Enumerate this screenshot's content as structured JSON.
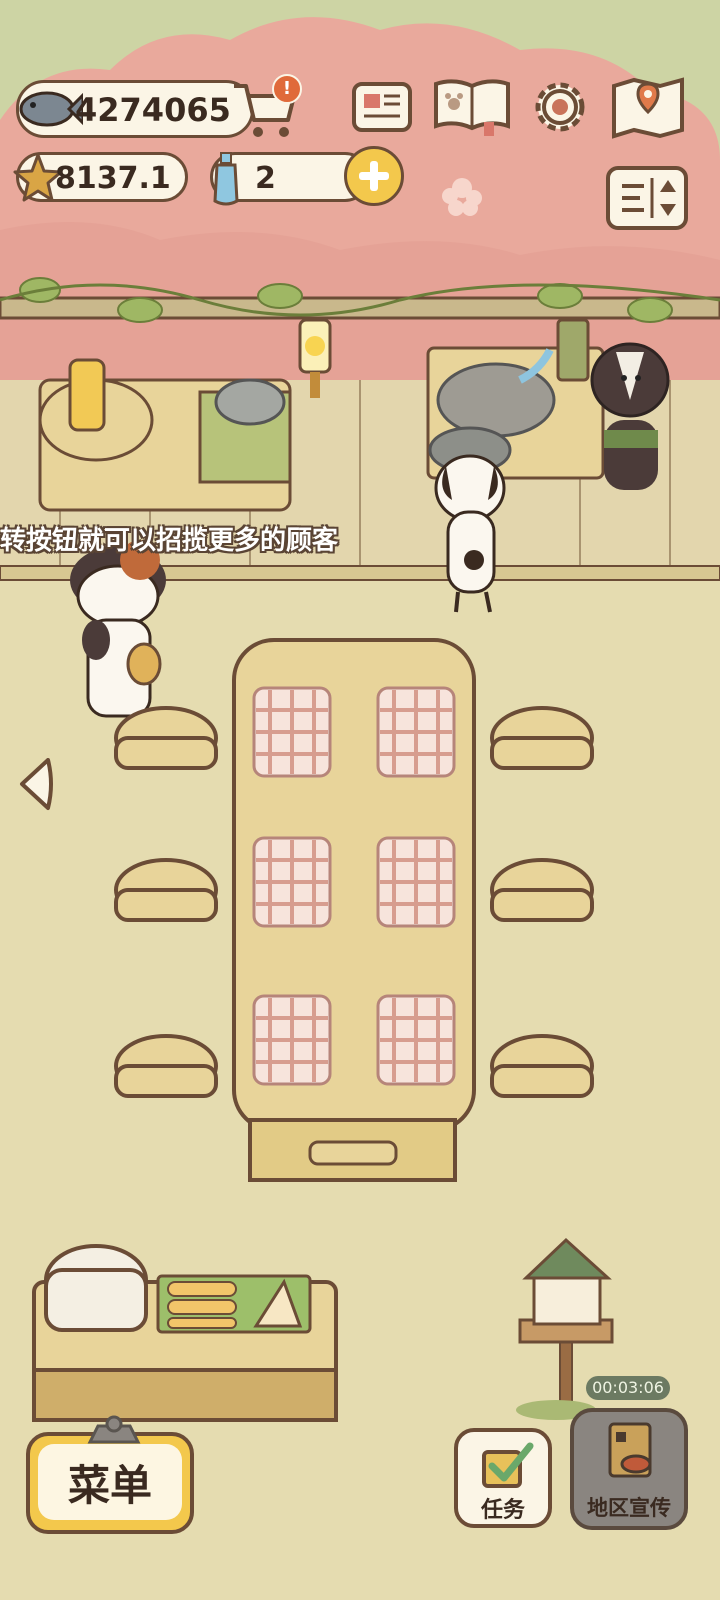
{
  "hud": {
    "fish_count": "4274065",
    "star_count": "8137.1",
    "bottle_count": "2"
  },
  "ticker": {
    "text": "转按钮就可以招揽更多的顾客"
  },
  "bottom": {
    "menu_label": "菜单",
    "tasks_label": "任务",
    "promo_label": "地区宣传",
    "promo_timer": "00:03:06"
  },
  "colors": {
    "background_wall": "#e9a99c",
    "floor": "#e5dcb0",
    "outline": "#6b4c36",
    "wood": "#e8d49a",
    "gold_button": "#f3c84c",
    "notify_badge": "#e06a3a"
  }
}
